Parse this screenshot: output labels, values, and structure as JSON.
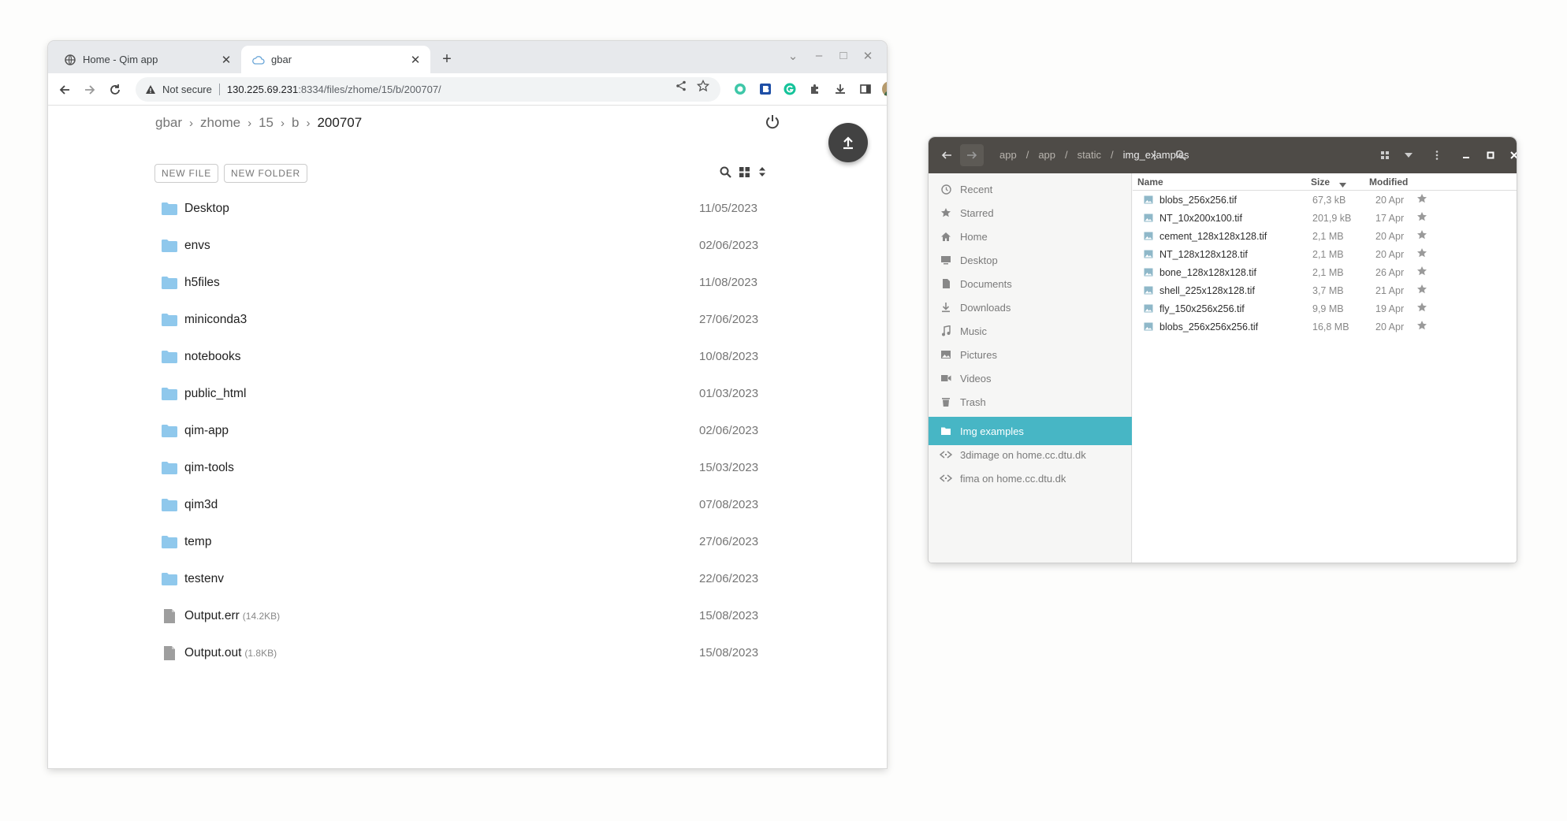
{
  "browser": {
    "tabs": [
      {
        "title": "Home - Qim app",
        "active": false
      },
      {
        "title": "gbar",
        "active": true
      }
    ],
    "security_label": "Not secure",
    "url_host": "130.225.69.231",
    "url_rest": ":8334/files/zhome/15/b/200707/",
    "breadcrumbs": [
      "gbar",
      "zhome",
      "15",
      "b",
      "200707"
    ],
    "buttons": {
      "new_file": "NEW FILE",
      "new_folder": "NEW FOLDER"
    },
    "files": [
      {
        "name": "Desktop",
        "type": "folder",
        "date": "11/05/2023"
      },
      {
        "name": "envs",
        "type": "folder",
        "date": "02/06/2023"
      },
      {
        "name": "h5files",
        "type": "folder",
        "date": "11/08/2023"
      },
      {
        "name": "miniconda3",
        "type": "folder",
        "date": "27/06/2023"
      },
      {
        "name": "notebooks",
        "type": "folder",
        "date": "10/08/2023"
      },
      {
        "name": "public_html",
        "type": "folder",
        "date": "01/03/2023"
      },
      {
        "name": "qim-app",
        "type": "folder",
        "date": "02/06/2023"
      },
      {
        "name": "qim-tools",
        "type": "folder",
        "date": "15/03/2023"
      },
      {
        "name": "qim3d",
        "type": "folder",
        "date": "07/08/2023"
      },
      {
        "name": "temp",
        "type": "folder",
        "date": "27/06/2023"
      },
      {
        "name": "testenv",
        "type": "folder",
        "date": "22/06/2023"
      },
      {
        "name": "Output.err",
        "type": "file",
        "size": "(14.2KB)",
        "date": "15/08/2023"
      },
      {
        "name": "Output.out",
        "type": "file",
        "size": "(1.8KB)",
        "date": "15/08/2023"
      }
    ],
    "colors": {
      "folder": "#8fc8ec",
      "file": "#9e9e9e",
      "fab": "#424242"
    }
  },
  "nautilus": {
    "path": [
      "app",
      "app",
      "static",
      "img_examples"
    ],
    "sidebar": [
      {
        "label": "Recent",
        "icon": "clock-icon"
      },
      {
        "label": "Starred",
        "icon": "star-icon"
      },
      {
        "label": "Home",
        "icon": "home-icon"
      },
      {
        "label": "Desktop",
        "icon": "desktop-icon"
      },
      {
        "label": "Documents",
        "icon": "document-icon"
      },
      {
        "label": "Downloads",
        "icon": "download-icon"
      },
      {
        "label": "Music",
        "icon": "music-icon"
      },
      {
        "label": "Pictures",
        "icon": "picture-icon"
      },
      {
        "label": "Videos",
        "icon": "video-icon"
      },
      {
        "label": "Trash",
        "icon": "trash-icon"
      },
      {
        "label": "Img examples",
        "icon": "folder-icon",
        "selected": true
      },
      {
        "label": "3dimage on home.cc.dtu.dk",
        "icon": "network-share-icon"
      },
      {
        "label": "fima on home.cc.dtu.dk",
        "icon": "network-share-icon"
      }
    ],
    "columns": {
      "name": "Name",
      "size": "Size",
      "modified": "Modified"
    },
    "files": [
      {
        "name": "blobs_256x256.tif",
        "size": "67,3 kB",
        "modified": "20 Apr"
      },
      {
        "name": "NT_10x200x100.tif",
        "size": "201,9 kB",
        "modified": "17 Apr"
      },
      {
        "name": "cement_128x128x128.tif",
        "size": "2,1 MB",
        "modified": "20 Apr"
      },
      {
        "name": "NT_128x128x128.tif",
        "size": "2,1 MB",
        "modified": "20 Apr"
      },
      {
        "name": "bone_128x128x128.tif",
        "size": "2,1 MB",
        "modified": "26 Apr"
      },
      {
        "name": "shell_225x128x128.tif",
        "size": "3,7 MB",
        "modified": "21 Apr"
      },
      {
        "name": "fly_150x256x256.tif",
        "size": "9,9 MB",
        "modified": "19 Apr"
      },
      {
        "name": "blobs_256x256x256.tif",
        "size": "16,8 MB",
        "modified": "20 Apr"
      }
    ],
    "colors": {
      "header": "#4e4b47",
      "selected": "#47b6c5"
    }
  }
}
